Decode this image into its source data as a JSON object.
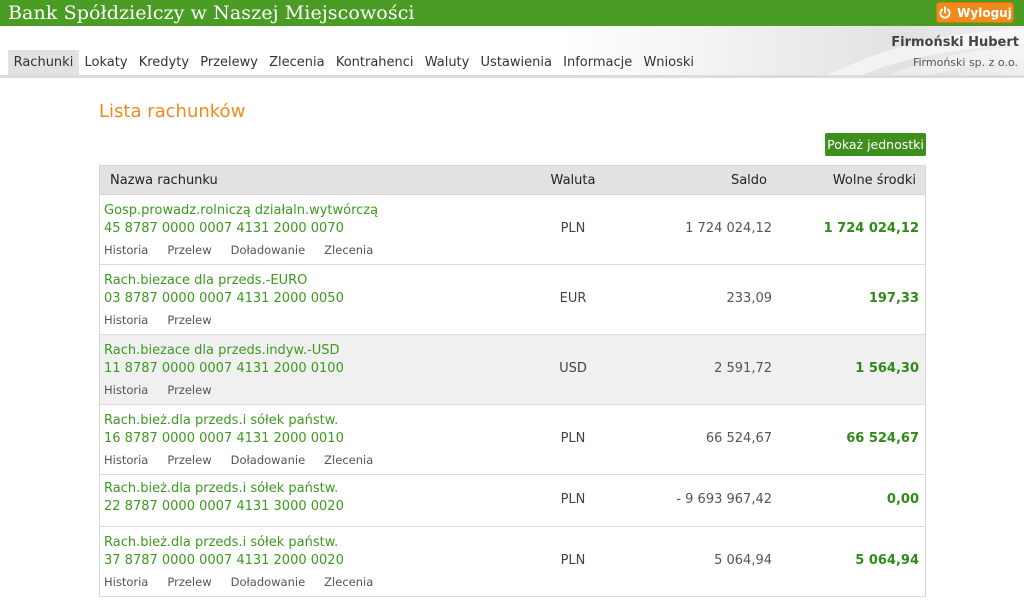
{
  "header": {
    "bank_name": "Bank Spółdzielczy w Naszej Miejscowości",
    "logout_label": "Wyloguj",
    "user_name": "Firmoński Hubert",
    "user_company": "Firmoński sp. z o.o."
  },
  "nav": {
    "tabs": [
      "Rachunki",
      "Lokaty",
      "Kredyty",
      "Przelewy",
      "Zlecenia",
      "Kontrahenci",
      "Waluty",
      "Ustawienia",
      "Informacje",
      "Wnioski"
    ],
    "active": "Rachunki"
  },
  "main": {
    "title": "Lista rachunków",
    "units_button": "Pokaż jednostki",
    "columns": {
      "name": "Nazwa rachunku",
      "currency": "Waluta",
      "balance": "Saldo",
      "available": "Wolne środki"
    },
    "accounts": [
      {
        "name": "Gosp.prowadz.rolniczą działaln.wytwórczą",
        "number": "45 8787 0000 0007 4131 2000 0070",
        "links": [
          "Historia",
          "Przelew",
          "Doładowanie",
          "Zlecenia"
        ],
        "currency": "PLN",
        "balance": "1 724 024,12",
        "available": "1 724 024,12"
      },
      {
        "name": "Rach.biezace dla przeds.-EURO",
        "number": "03 8787 0000 0007 4131 2000 0050",
        "links": [
          "Historia",
          "Przelew"
        ],
        "currency": "EUR",
        "balance": "233,09",
        "available": "197,33"
      },
      {
        "name": "Rach.biezace dla przeds.indyw.-USD",
        "number": "11 8787 0000 0007 4131 2000 0100",
        "links": [
          "Historia",
          "Przelew"
        ],
        "currency": "USD",
        "balance": "2 591,72",
        "available": "1 564,30"
      },
      {
        "name": "Rach.bież.dla przeds.i sółek państw.",
        "number": "16 8787 0000 0007 4131 2000 0010",
        "links": [
          "Historia",
          "Przelew",
          "Doładowanie",
          "Zlecenia"
        ],
        "currency": "PLN",
        "balance": "66 524,67",
        "available": "66 524,67"
      },
      {
        "name": "Rach.bież.dla przeds.i sółek państw.",
        "number": "22 8787 0000 0007 4131 3000 0020",
        "links": [],
        "currency": "PLN",
        "balance": "- 9 693 967,42",
        "available": "0,00"
      },
      {
        "name": "Rach.bież.dla przeds.i sółek państw.",
        "number": "37 8787 0000 0007 4131 2000 0020",
        "links": [
          "Historia",
          "Przelew",
          "Doładowanie",
          "Zlecenia"
        ],
        "currency": "PLN",
        "balance": "5 064,94",
        "available": "5 064,94"
      }
    ]
  },
  "colors": {
    "brand_green": "#4a9c25",
    "accent_orange": "#ef8a1c",
    "link_green": "#3c9a1e"
  }
}
